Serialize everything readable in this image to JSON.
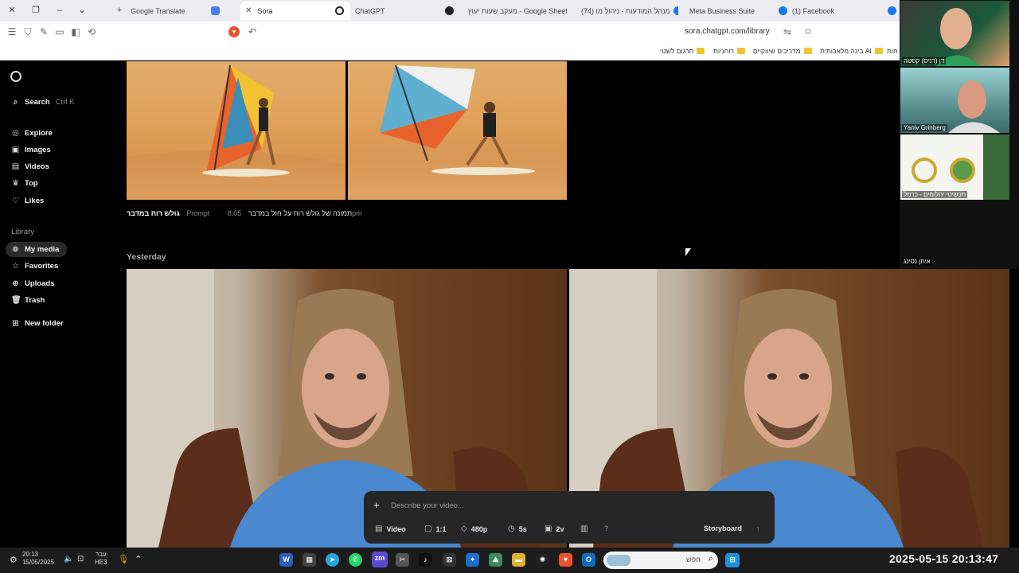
{
  "browser": {
    "tabs": [
      {
        "label": "Google Translate",
        "active": false
      },
      {
        "label": "Sora",
        "active": true
      },
      {
        "label": "ChatGPT",
        "active": false
      },
      {
        "label": "מעקב שעות יעוץ - Google Sheets",
        "active": false
      },
      {
        "label": "(74) מנהל המודעות - ניהול מו",
        "active": false
      },
      {
        "label": "Meta Business Suite",
        "active": false
      },
      {
        "label": "(1) Facebook",
        "active": false
      }
    ],
    "url": "sora.chatgpt.com/library",
    "bookmarks": [
      "תרגום לשטי",
      "רוחניות",
      "מדריכים שיווקיים",
      "בינה מלאכותית AI",
      "חות"
    ]
  },
  "sidebar": {
    "search_label": "Search",
    "search_shortcut": "Ctrl K",
    "nav": [
      {
        "label": "Explore",
        "icon": "compass-icon"
      },
      {
        "label": "Images",
        "icon": "image-icon"
      },
      {
        "label": "Videos",
        "icon": "video-icon"
      },
      {
        "label": "Top",
        "icon": "trophy-icon"
      },
      {
        "label": "Likes",
        "icon": "heart-icon"
      }
    ],
    "library_heading": "Library",
    "library": [
      {
        "label": "My media",
        "icon": "media-icon",
        "selected": true
      },
      {
        "label": "Favorites",
        "icon": "star-icon"
      },
      {
        "label": "Uploads",
        "icon": "upload-icon"
      },
      {
        "label": "Trash",
        "icon": "trash-icon"
      }
    ],
    "new_folder": "New folder"
  },
  "main": {
    "entry1": {
      "title": "גולש רוח במדבר",
      "prompt_label": "Prompt",
      "prompt_text": "תמונה של גולש רוח על חול במדבר",
      "time": "8:05pm"
    },
    "yesterday_label": "Yesterday"
  },
  "composer": {
    "placeholder": "Describe your video...",
    "options": {
      "type": "Video",
      "aspect": "1:1",
      "resolution": "480p",
      "duration": "5s",
      "variations": "2v",
      "help": "?",
      "storyboard": "Storyboard"
    }
  },
  "zoom": {
    "participants": [
      "דן (דניס) קסטה",
      "Yaniv Grinberg",
      "תכשיטי יהלומים - כרמל",
      "איתן נסינג"
    ]
  },
  "taskbar": {
    "left_time": "20:13",
    "left_date": "15/05/2025",
    "lang_top": "עבר",
    "lang_bottom": "HE3",
    "search_placeholder": "חפש",
    "big_clock": "2025-05-15  20:13:47"
  },
  "colors": {
    "page_bg": "#000000",
    "sidebar_selected": "#2a2a2a",
    "composer_bg": "#262626",
    "accent_blue": "#4a90e2"
  }
}
